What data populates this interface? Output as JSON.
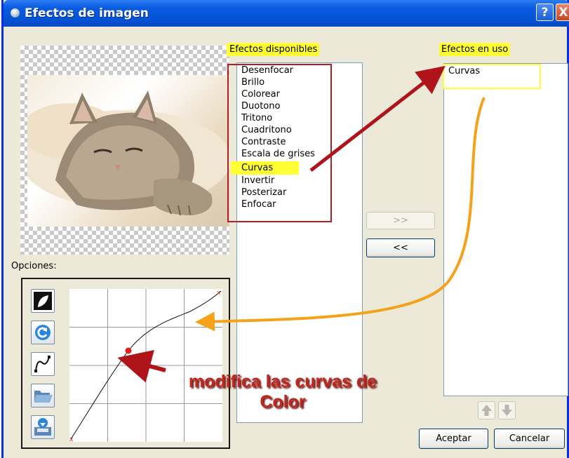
{
  "window": {
    "title": "Efectos de imagen",
    "help_label": "?",
    "close_label": "X"
  },
  "available": {
    "label": "Efectos disponibles",
    "items": [
      "Desenfocar",
      "Brillo",
      "Colorear",
      "Duotono",
      "Tritono",
      "Cuadritono",
      "Contraste",
      "Escala de grises",
      "Curvas",
      "Invertir",
      "Posterizar",
      "Enfocar"
    ],
    "selected": "Curvas"
  },
  "in_use": {
    "label": "Efectos en uso",
    "items": [
      "Curvas"
    ]
  },
  "transfer": {
    "add_label": ">>",
    "remove_label": "<<"
  },
  "options": {
    "label": "Opciones:"
  },
  "curve_tools": [
    "invert-curve-icon",
    "reset-icon",
    "freehand-curve-icon",
    "open-folder-icon",
    "save-icon"
  ],
  "annotation": {
    "text": "modifica las curvas de Color"
  },
  "buttons": {
    "accept": "Aceptar",
    "cancel": "Cancelar"
  },
  "colors": {
    "titlebar": "#0a5be0",
    "highlight": "#ffff33",
    "annotation_red": "#c0281f",
    "orange_arrow": "#f5a21b",
    "curve_point": "#e0211c"
  }
}
